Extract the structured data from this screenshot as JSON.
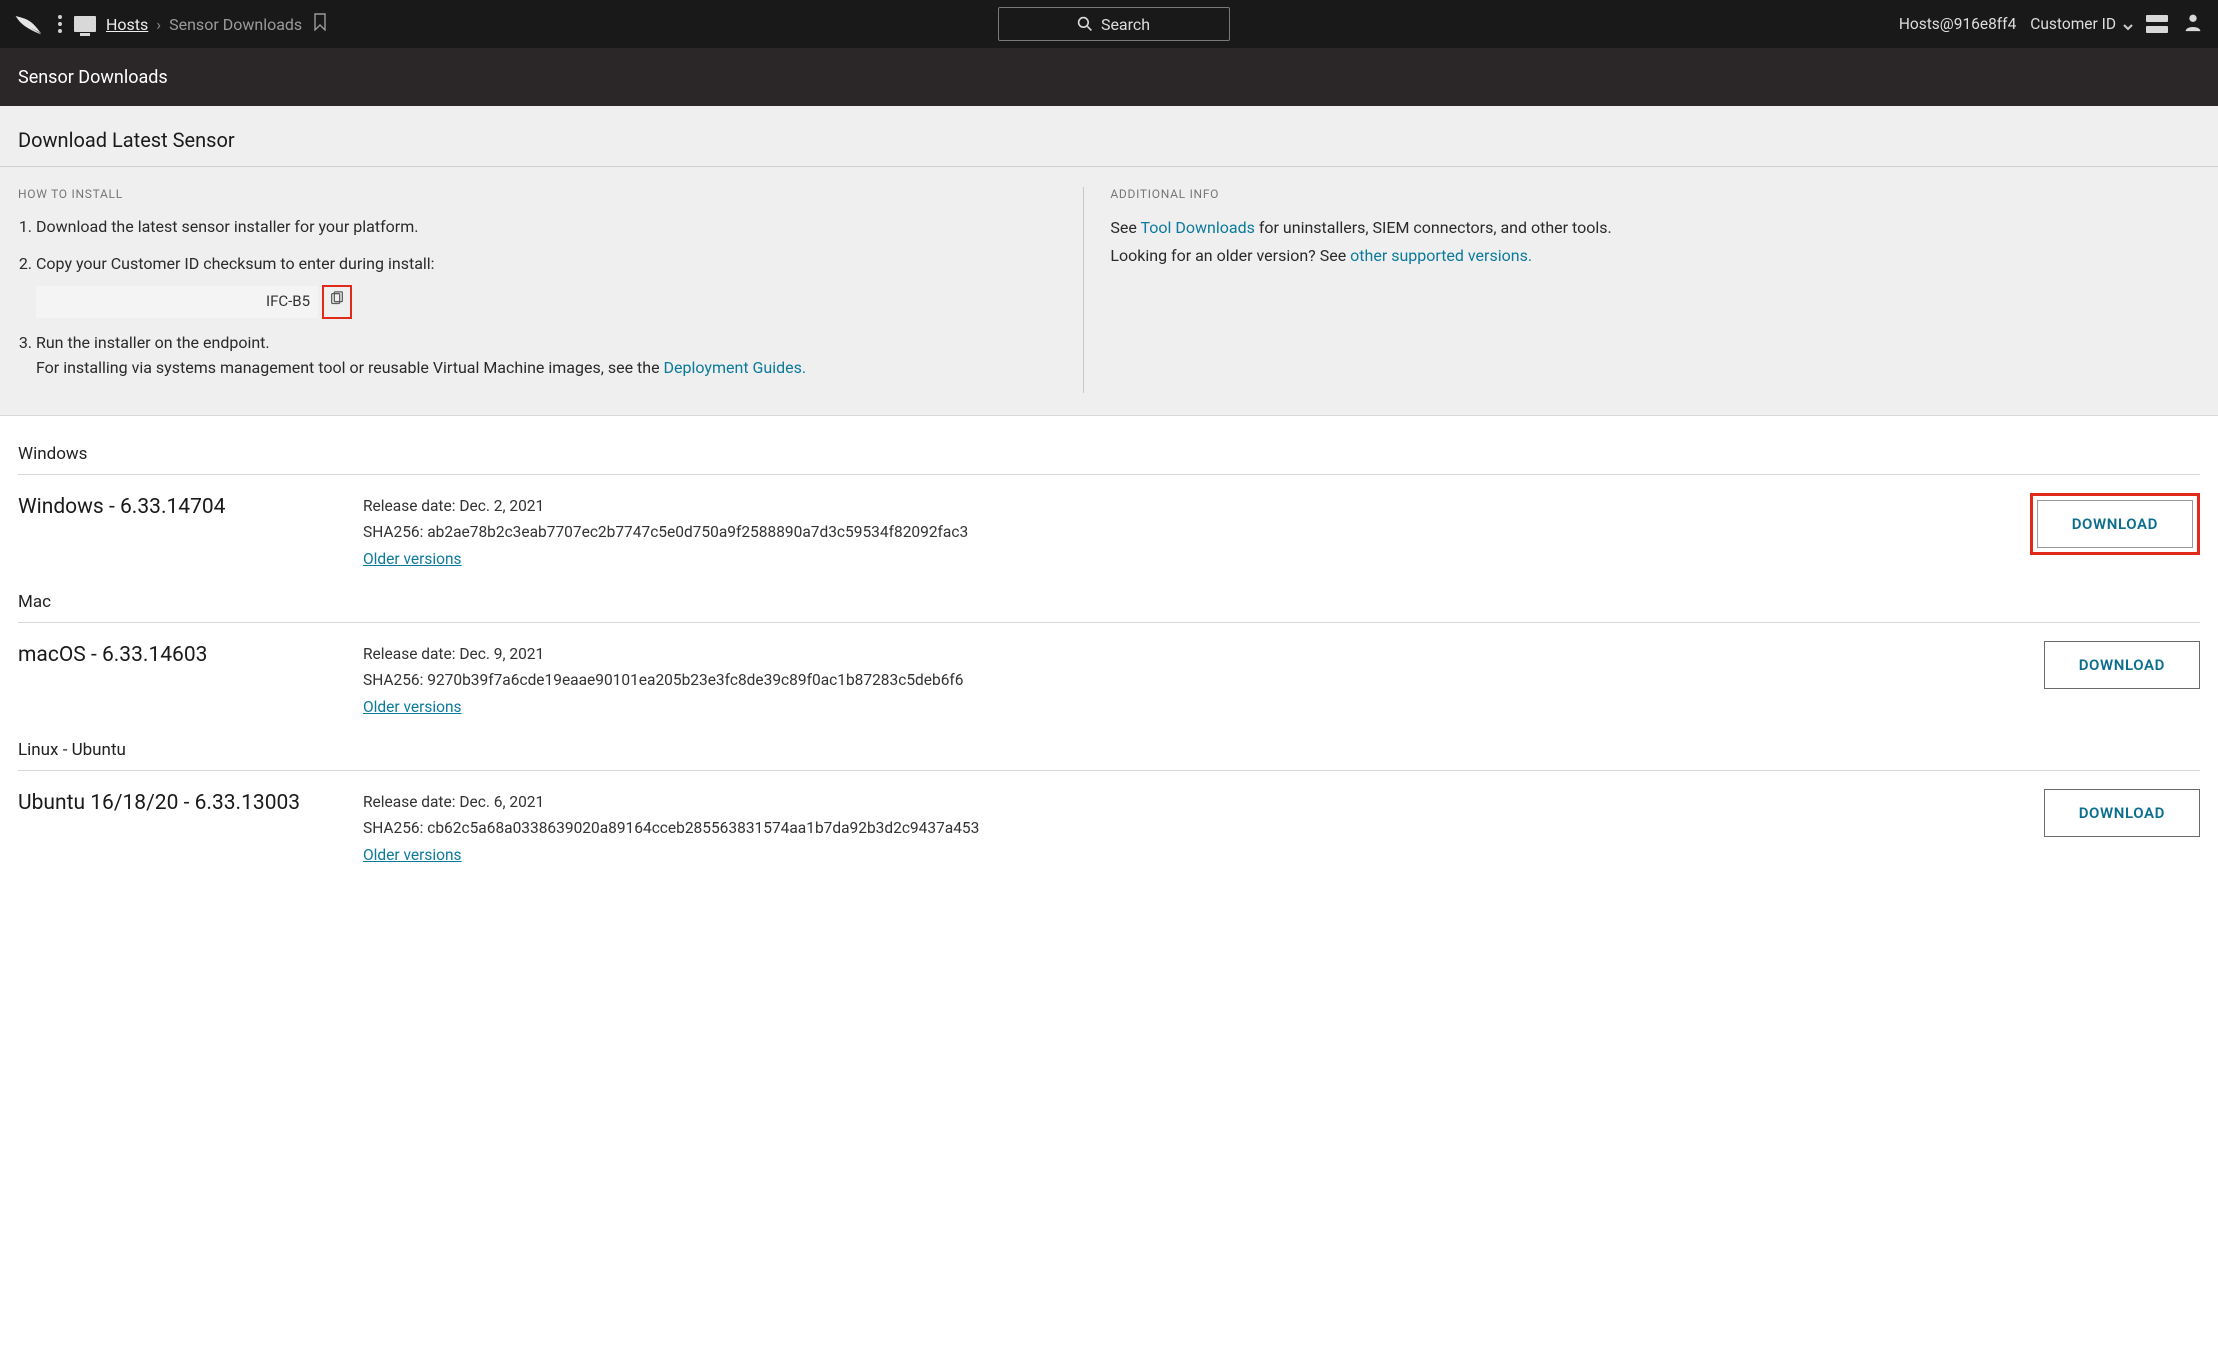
{
  "topbar": {
    "breadcrumb": {
      "hosts": "Hosts",
      "sep": "›",
      "current": "Sensor Downloads"
    },
    "search_label": "Search",
    "account": "Hosts@916e8ff4",
    "customer_id_label": "Customer ID"
  },
  "subhead": {
    "title": "Sensor Downloads"
  },
  "download_section": {
    "title": "Download Latest Sensor",
    "how_to_head": "HOW TO INSTALL",
    "steps": {
      "s1": "Download the latest sensor installer for your platform.",
      "s2": "Copy your Customer ID checksum to enter during install:",
      "checksum": "IFC-B5",
      "s3a": "Run the installer on the endpoint.",
      "s3b": "For installing via systems management tool or reusable Virtual Machine images, see the ",
      "s3link": "Deployment Guides."
    },
    "addl_head": "ADDITIONAL INFO",
    "addl_p1_a": "See ",
    "addl_p1_link": "Tool Downloads",
    "addl_p1_b": " for uninstallers, SIEM connectors, and other tools.",
    "addl_p2_a": "Looking for an older version? See ",
    "addl_p2_link": "other supported versions."
  },
  "platforms": [
    {
      "group": "Windows",
      "name": "Windows - 6.33.14704",
      "release": "Release date: Dec. 2, 2021",
      "sha": "SHA256: ab2ae78b2c3eab7707ec2b7747c5e0d750a9f2588890a7d3c59534f82092fac3",
      "older": "Older versions",
      "btn": "DOWNLOAD",
      "highlight": true
    },
    {
      "group": "Mac",
      "name": "macOS - 6.33.14603",
      "release": "Release date: Dec. 9, 2021",
      "sha": "SHA256: 9270b39f7a6cde19eaae90101ea205b23e3fc8de39c89f0ac1b87283c5deb6f6",
      "older": "Older versions",
      "btn": "DOWNLOAD",
      "highlight": false
    },
    {
      "group": "Linux - Ubuntu",
      "name": "Ubuntu 16/18/20 - 6.33.13003",
      "release": "Release date: Dec. 6, 2021",
      "sha": "SHA256: cb62c5a68a0338639020a89164cceb285563831574aa1b7da92b3d2c9437a453",
      "older": "Older versions",
      "btn": "DOWNLOAD",
      "highlight": false
    }
  ]
}
